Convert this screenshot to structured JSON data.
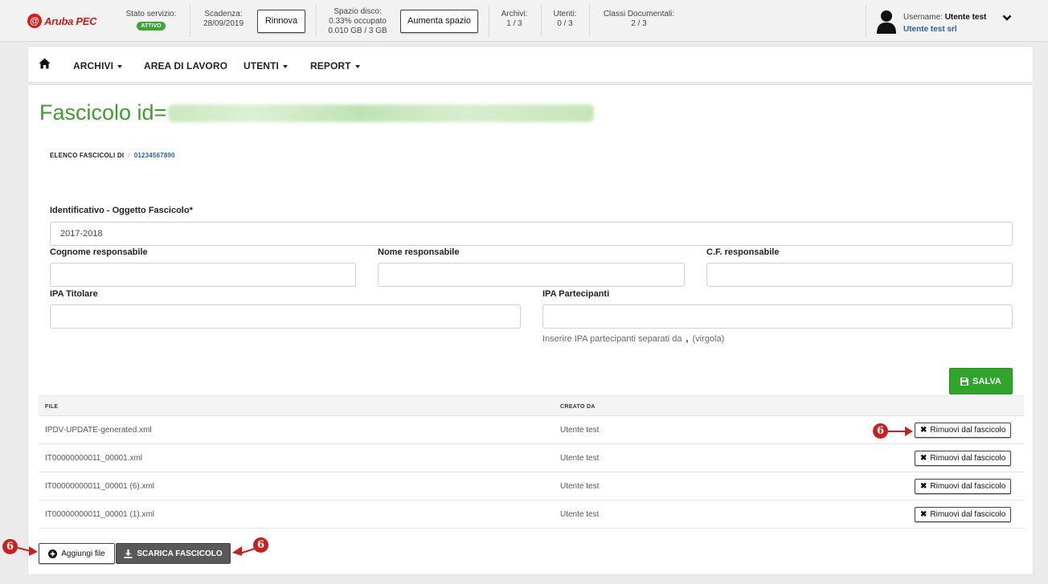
{
  "topbar": {
    "logo_text": "Aruba PEC",
    "stato_label": "Stato servizio:",
    "stato_badge": "ATTIVO",
    "scadenza_label": "Scadenza:",
    "scadenza_value": "28/09/2019",
    "rinnova_label": "Rinnova",
    "spazio_label": "Spazio disco:",
    "spazio_pct": "0.33% occupato",
    "spazio_usage": "0.010 GB / 3 GB",
    "aumenta_label": "Aumenta spazio",
    "archivi_label": "Archivi:",
    "archivi_value": "1 / 3",
    "utenti_label": "Utenti:",
    "utenti_value": "0 / 3",
    "classi_label": "Classi Documentali:",
    "classi_value": "2 / 3",
    "username_label": "Username:",
    "username_value": "Utente test",
    "company": "Utente test srl"
  },
  "nav": {
    "items": [
      {
        "label": "ARCHIVI",
        "dropdown": true
      },
      {
        "label": "AREA DI LAVORO",
        "dropdown": false
      },
      {
        "label": "UTENTI",
        "dropdown": true
      },
      {
        "label": "REPORT",
        "dropdown": true
      }
    ]
  },
  "page": {
    "title": "Fascicolo id=",
    "breadcrumb": {
      "parent": "ELENCO FASCICOLI DI",
      "current": "01234567890"
    }
  },
  "form": {
    "oggetto_label": "Identificativo - Oggetto Fascicolo*",
    "oggetto_value": "2017-2018",
    "cognome_label": "Cognome responsabile",
    "cognome_value": "",
    "nome_label": "Nome responsabile",
    "nome_value": "",
    "cf_label": "C.F. responsabile",
    "cf_value": "",
    "ipa_titolare_label": "IPA Titolare",
    "ipa_titolare_value": "",
    "ipa_partecipanti_label": "IPA Partecipanti",
    "ipa_partecipanti_value": "",
    "help_pre": "Inserire IPA partecipanti separati da",
    "help_char": ",",
    "help_post": "(virgola)",
    "save_label": "SALVA"
  },
  "table": {
    "col_file": "FILE",
    "col_creato": "CREATO DA",
    "remove_label": "Rimuovi dal fascicolo",
    "rows": [
      {
        "file": "IPDV-UPDATE-generated.xml",
        "creato_da": "Utente test"
      },
      {
        "file": "IT00000000011_00001.xml",
        "creato_da": "Utente test"
      },
      {
        "file": "IT00000000011_00001 (6).xml",
        "creato_da": "Utente test"
      },
      {
        "file": "IT00000000011_00001 (1).xml",
        "creato_da": "Utente test"
      }
    ]
  },
  "actions": {
    "add_file_label": "Aggiungi file",
    "download_label": "SCARICA FASCICOLO"
  },
  "annotations": {
    "marker_label": "6",
    "color": "#c8201f"
  },
  "colors": {
    "brand_green": "#3d9e2a",
    "save_green": "#2fa52c",
    "logo_red": "#d3201f",
    "link_blue": "#2a5f9e"
  }
}
